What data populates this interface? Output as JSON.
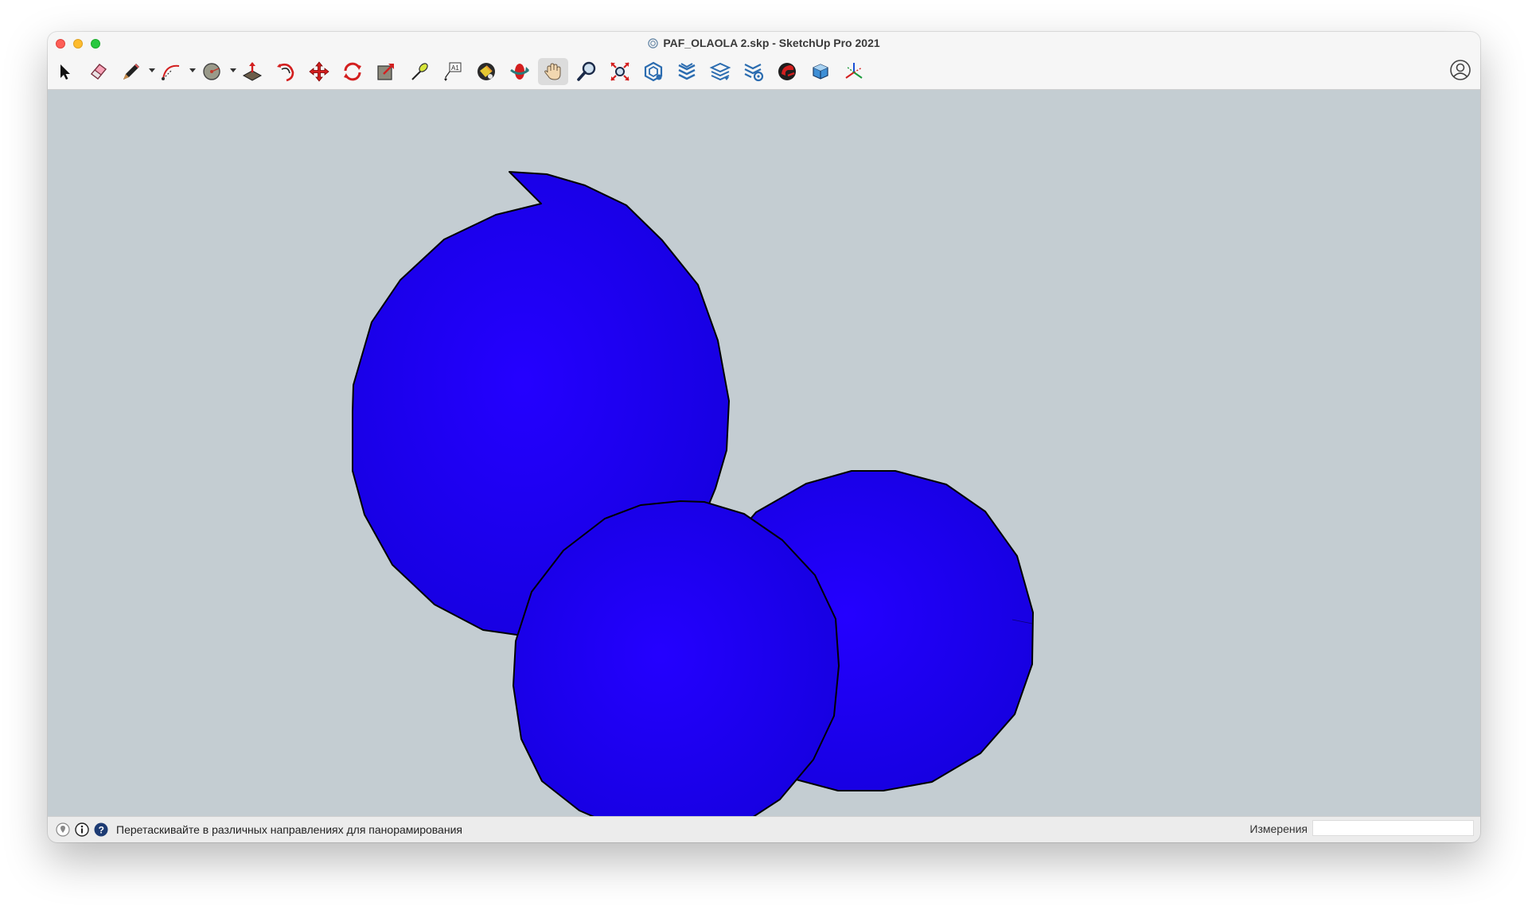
{
  "window": {
    "title": "PAF_OLAOLA 2.skp - SketchUp Pro 2021"
  },
  "toolbar": {
    "tools": [
      {
        "name": "select-tool",
        "icon": "arrow-cursor-icon"
      },
      {
        "name": "eraser-tool",
        "icon": "eraser-icon"
      },
      {
        "name": "line-tool",
        "icon": "pencil-icon",
        "dropdown": true
      },
      {
        "name": "arc-tool",
        "icon": "arc-icon",
        "dropdown": true
      },
      {
        "name": "shape-tool",
        "icon": "circle-shape-icon",
        "dropdown": true
      },
      {
        "name": "push-pull-tool",
        "icon": "push-pull-icon"
      },
      {
        "name": "offset-tool",
        "icon": "offset-icon"
      },
      {
        "name": "move-tool",
        "icon": "move-icon"
      },
      {
        "name": "rotate-tool",
        "icon": "rotate-icon"
      },
      {
        "name": "scale-tool",
        "icon": "scale-icon"
      },
      {
        "name": "tape-measure-tool",
        "icon": "tape-measure-icon"
      },
      {
        "name": "text-tool",
        "icon": "text-icon"
      },
      {
        "name": "paint-bucket-tool",
        "icon": "paint-bucket-icon"
      },
      {
        "name": "orbit-tool",
        "icon": "orbit-icon"
      },
      {
        "name": "pan-tool",
        "icon": "hand-icon",
        "active": true
      },
      {
        "name": "zoom-tool",
        "icon": "magnifier-icon"
      },
      {
        "name": "zoom-extents-tool",
        "icon": "zoom-extents-icon"
      },
      {
        "name": "3d-warehouse-tool",
        "icon": "warehouse-icon"
      },
      {
        "name": "extension-warehouse-tool",
        "icon": "extension-warehouse-icon"
      },
      {
        "name": "layout-tool",
        "icon": "layout-icon"
      },
      {
        "name": "extension-manager-tool",
        "icon": "extension-manager-icon"
      },
      {
        "name": "ruby-console-tool",
        "icon": "ruby-icon"
      },
      {
        "name": "components-tool",
        "icon": "component-icon"
      },
      {
        "name": "axes-tool",
        "icon": "axes-icon"
      }
    ],
    "account_icon": "account-icon"
  },
  "scene": {
    "background": "#c4cdd2",
    "fill_color": "#1a00f0",
    "edge_color": "#000000",
    "objects": [
      "sphere-large",
      "sphere-right",
      "sphere-front"
    ]
  },
  "statusbar": {
    "message": "Перетаскивайте в различных направлениях для панорамирования",
    "measurements_label": "Измерения",
    "measurements_value": ""
  }
}
